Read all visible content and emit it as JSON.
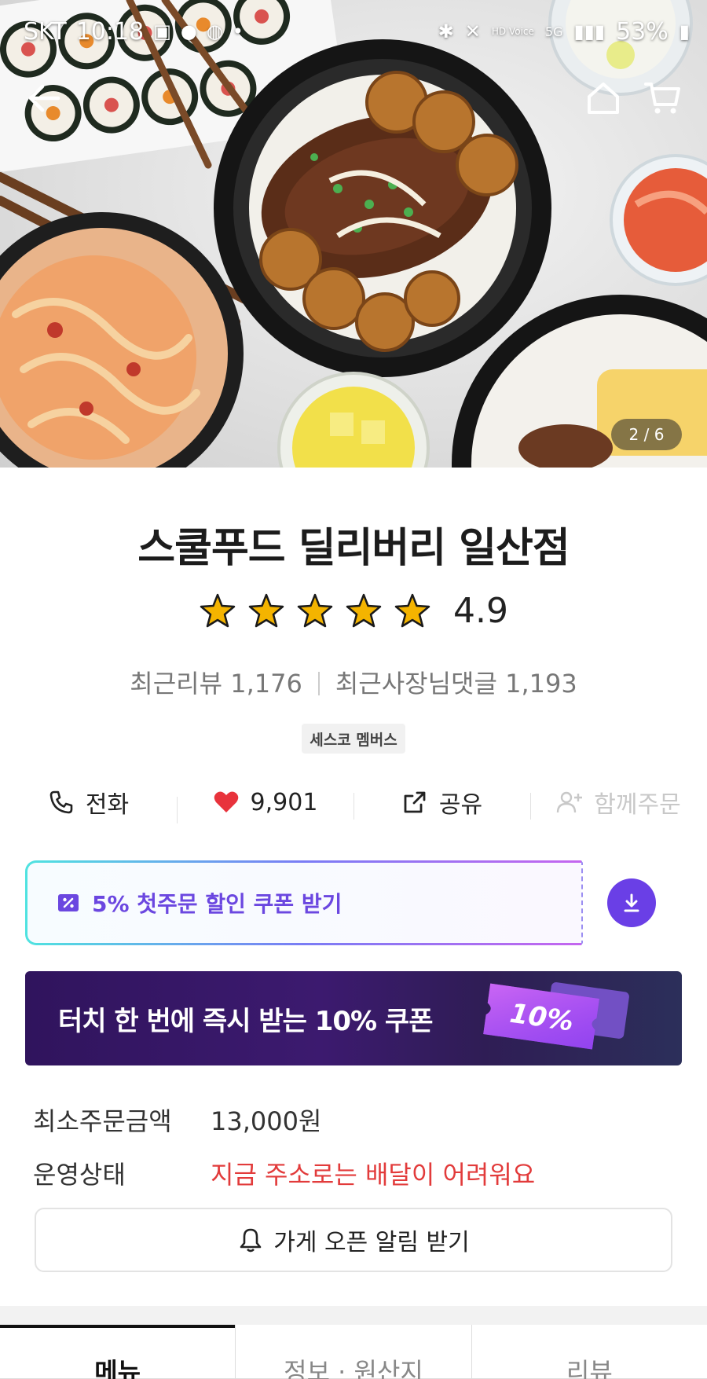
{
  "status_bar": {
    "carrier": "SKT",
    "time": "10:18",
    "battery": "53%",
    "network": "5G",
    "hd_voice": "HD Voice"
  },
  "hero": {
    "pager": "2 / 6",
    "icons": [
      "back-arrow-icon",
      "home-icon",
      "cart-icon"
    ]
  },
  "store": {
    "name": "스쿨푸드 딜리버리 일산점",
    "rating": "4.9",
    "stars_filled": 5,
    "recent_reviews": "최근리뷰 1,176",
    "owner_replies": "최근사장님댓글 1,193",
    "badge": "세스코 멤버스"
  },
  "actions": {
    "call": "전화",
    "likes": "9,901",
    "share": "공유",
    "group_order": "함께주문"
  },
  "coupon": {
    "label": "5% 첫주문 할인 쿠폰 받기"
  },
  "banner": {
    "text": "터치 한 번에 즉시 받는 10% 쿠폰",
    "ticket": "10%"
  },
  "info": {
    "min_order_label": "최소주문금액",
    "min_order_value": "13,000원",
    "status_label": "운영상태",
    "status_value": "지금 주소로는 배달이 어려워요"
  },
  "alarm_button": "가게 오픈 알림 받기",
  "tabs": [
    "메뉴",
    "정보 · 원산지",
    "리뷰"
  ],
  "colors": {
    "accent_purple": "#6b47e0",
    "alert_red": "#e23b3b",
    "heart_red": "#e8333c",
    "star_gold": "#f4b400"
  }
}
